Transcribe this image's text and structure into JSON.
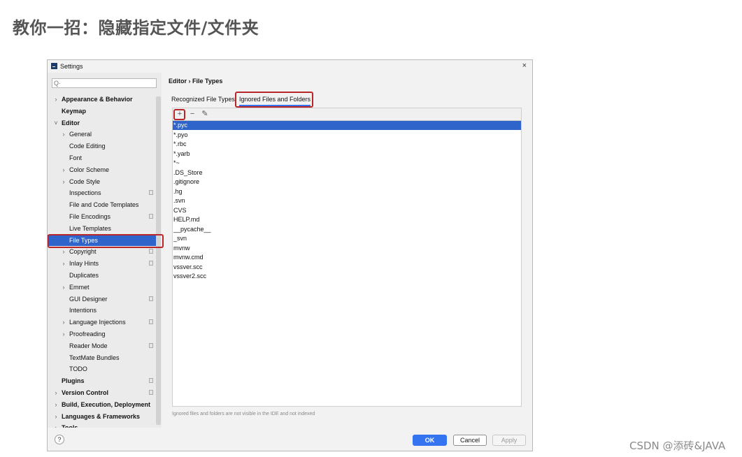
{
  "article": {
    "heading": "教你一招：隐藏指定文件/文件夹",
    "watermark": "CSDN @添砖&JAVA"
  },
  "dialog": {
    "title": "Settings",
    "close_glyph": "×",
    "app_icon": "intellij-app-icon"
  },
  "search": {
    "placeholder": "",
    "icon": "Q·"
  },
  "sidebar": {
    "items": [
      {
        "label": "Appearance & Behavior",
        "level": 0,
        "arrow": "›",
        "bold": true,
        "project": false
      },
      {
        "label": "Keymap",
        "level": 0,
        "arrow": "",
        "bold": true,
        "project": false
      },
      {
        "label": "Editor",
        "level": 0,
        "arrow": "˅",
        "bold": true,
        "project": false
      },
      {
        "label": "General",
        "level": 1,
        "arrow": "›",
        "bold": false,
        "project": false
      },
      {
        "label": "Code Editing",
        "level": 1,
        "arrow": "",
        "bold": false,
        "project": false
      },
      {
        "label": "Font",
        "level": 1,
        "arrow": "",
        "bold": false,
        "project": false
      },
      {
        "label": "Color Scheme",
        "level": 1,
        "arrow": "›",
        "bold": false,
        "project": false
      },
      {
        "label": "Code Style",
        "level": 1,
        "arrow": "›",
        "bold": false,
        "project": false
      },
      {
        "label": "Inspections",
        "level": 1,
        "arrow": "",
        "bold": false,
        "project": true
      },
      {
        "label": "File and Code Templates",
        "level": 1,
        "arrow": "",
        "bold": false,
        "project": false
      },
      {
        "label": "File Encodings",
        "level": 1,
        "arrow": "",
        "bold": false,
        "project": true
      },
      {
        "label": "Live Templates",
        "level": 1,
        "arrow": "",
        "bold": false,
        "project": false
      },
      {
        "label": "File Types",
        "level": 1,
        "arrow": "",
        "bold": false,
        "project": false,
        "selected": true
      },
      {
        "label": "Copyright",
        "level": 1,
        "arrow": "›",
        "bold": false,
        "project": true
      },
      {
        "label": "Inlay Hints",
        "level": 1,
        "arrow": "›",
        "bold": false,
        "project": true
      },
      {
        "label": "Duplicates",
        "level": 1,
        "arrow": "",
        "bold": false,
        "project": false
      },
      {
        "label": "Emmet",
        "level": 1,
        "arrow": "›",
        "bold": false,
        "project": false
      },
      {
        "label": "GUI Designer",
        "level": 1,
        "arrow": "",
        "bold": false,
        "project": true
      },
      {
        "label": "Intentions",
        "level": 1,
        "arrow": "",
        "bold": false,
        "project": false
      },
      {
        "label": "Language Injections",
        "level": 1,
        "arrow": "›",
        "bold": false,
        "project": true
      },
      {
        "label": "Proofreading",
        "level": 1,
        "arrow": "›",
        "bold": false,
        "project": false
      },
      {
        "label": "Reader Mode",
        "level": 1,
        "arrow": "",
        "bold": false,
        "project": true
      },
      {
        "label": "TextMate Bundles",
        "level": 1,
        "arrow": "",
        "bold": false,
        "project": false
      },
      {
        "label": "TODO",
        "level": 1,
        "arrow": "",
        "bold": false,
        "project": false
      },
      {
        "label": "Plugins",
        "level": 0,
        "arrow": "",
        "bold": true,
        "project": true
      },
      {
        "label": "Version Control",
        "level": 0,
        "arrow": "›",
        "bold": true,
        "project": true
      },
      {
        "label": "Build, Execution, Deployment",
        "level": 0,
        "arrow": "›",
        "bold": true,
        "project": false
      },
      {
        "label": "Languages & Frameworks",
        "level": 0,
        "arrow": "›",
        "bold": true,
        "project": false
      },
      {
        "label": "Tools",
        "level": 0,
        "arrow": "›",
        "bold": true,
        "project": false
      }
    ]
  },
  "main": {
    "breadcrumb": "Editor  ›  File Types",
    "tabs": [
      {
        "label": "Recognized File Types",
        "active": false
      },
      {
        "label": "Ignored Files and Folders",
        "active": true
      }
    ],
    "toolbar": {
      "add": "+",
      "remove": "−",
      "edit": "✎"
    },
    "ignored_patterns": [
      "*.pyc",
      "*.pyo",
      "*.rbc",
      "*.yarb",
      "*~",
      ".DS_Store",
      ".gitignore",
      ".hg",
      ".svn",
      "CVS",
      "HELP.md",
      "__pycache__",
      "_svn",
      "mvnw",
      "mvnw.cmd",
      "vssver.scc",
      "vssver2.scc"
    ],
    "selected_pattern": "*.pyc",
    "footnote": "Ignored files and folders are not visible in the IDE and not indexed"
  },
  "buttons": {
    "help": "?",
    "ok": "OK",
    "cancel": "Cancel",
    "apply": "Apply"
  },
  "colors": {
    "selection": "#2f65ca",
    "annotation_box": "#b8262a",
    "primary_button": "#3574f0"
  }
}
